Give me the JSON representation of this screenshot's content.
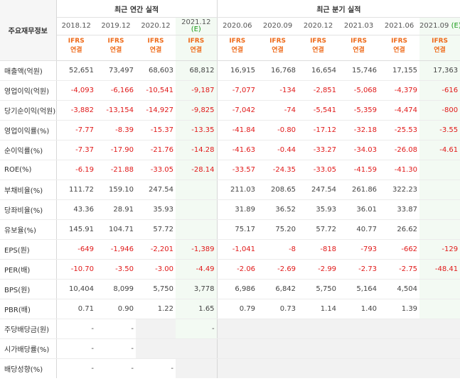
{
  "header": {
    "corner_label": "주요재무정보",
    "annual_title": "최근 연간 실적",
    "quarter_title": "최근 분기 실적",
    "annual_periods": [
      {
        "label": "2018.12",
        "est": ""
      },
      {
        "label": "2019.12",
        "est": ""
      },
      {
        "label": "2020.12",
        "est": ""
      },
      {
        "label": "2021.12",
        "est": "(E)"
      }
    ],
    "quarter_periods": [
      {
        "label": "2020.06",
        "est": ""
      },
      {
        "label": "2020.09",
        "est": ""
      },
      {
        "label": "2020.12",
        "est": ""
      },
      {
        "label": "2021.03",
        "est": ""
      },
      {
        "label": "2021.06",
        "est": ""
      },
      {
        "label": "2021.09",
        "est": "(E)"
      }
    ],
    "ifrs_label": "IFRS",
    "consol_label": "연결"
  },
  "rows": [
    {
      "label": "매출액(억원)",
      "values": [
        "52,651",
        "73,497",
        "68,603",
        "68,812",
        "16,915",
        "16,768",
        "16,654",
        "15,746",
        "17,155",
        "17,363"
      ]
    },
    {
      "label": "영업이익(억원)",
      "values": [
        "-4,093",
        "-6,166",
        "-10,541",
        "-9,187",
        "-7,077",
        "-134",
        "-2,851",
        "-5,068",
        "-4,379",
        "-616"
      ]
    },
    {
      "label": "당기순이익(억원)",
      "values": [
        "-3,882",
        "-13,154",
        "-14,927",
        "-9,825",
        "-7,042",
        "-74",
        "-5,541",
        "-5,359",
        "-4,474",
        "-800"
      ]
    },
    {
      "label": "영업이익률(%)",
      "values": [
        "-7.77",
        "-8.39",
        "-15.37",
        "-13.35",
        "-41.84",
        "-0.80",
        "-17.12",
        "-32.18",
        "-25.53",
        "-3.55"
      ]
    },
    {
      "label": "순이익률(%)",
      "values": [
        "-7.37",
        "-17.90",
        "-21.76",
        "-14.28",
        "-41.63",
        "-0.44",
        "-33.27",
        "-34.03",
        "-26.08",
        "-4.61"
      ]
    },
    {
      "label": "ROE(%)",
      "values": [
        "-6.19",
        "-21.88",
        "-33.05",
        "-28.14",
        "-33.57",
        "-24.35",
        "-33.05",
        "-41.59",
        "-41.30",
        ""
      ]
    },
    {
      "label": "부채비율(%)",
      "values": [
        "111.72",
        "159.10",
        "247.54",
        "",
        "211.03",
        "208.65",
        "247.54",
        "261.86",
        "322.23",
        ""
      ]
    },
    {
      "label": "당좌비율(%)",
      "values": [
        "43.36",
        "28.91",
        "35.93",
        "",
        "31.89",
        "36.52",
        "35.93",
        "36.01",
        "33.87",
        ""
      ]
    },
    {
      "label": "유보율(%)",
      "values": [
        "145.91",
        "104.71",
        "57.72",
        "",
        "75.17",
        "75.20",
        "57.72",
        "40.77",
        "26.62",
        ""
      ]
    },
    {
      "label": "EPS(원)",
      "values": [
        "-649",
        "-1,946",
        "-2,201",
        "-1,389",
        "-1,041",
        "-8",
        "-818",
        "-793",
        "-662",
        "-129"
      ]
    },
    {
      "label": "PER(배)",
      "values": [
        "-10.70",
        "-3.50",
        "-3.00",
        "-4.49",
        "-2.06",
        "-2.69",
        "-2.99",
        "-2.73",
        "-2.75",
        "-48.41"
      ]
    },
    {
      "label": "BPS(원)",
      "values": [
        "10,404",
        "8,099",
        "5,750",
        "3,778",
        "6,986",
        "6,842",
        "5,750",
        "5,164",
        "4,504",
        ""
      ]
    },
    {
      "label": "PBR(배)",
      "values": [
        "0.71",
        "0.90",
        "1.22",
        "1.65",
        "0.79",
        "0.73",
        "1.14",
        "1.40",
        "1.39",
        ""
      ]
    },
    {
      "label": "주당배당금(원)",
      "values": [
        "-",
        "-",
        "",
        "-",
        "",
        "",
        "",
        "",
        "",
        ""
      ]
    },
    {
      "label": "시가배당률(%)",
      "values": [
        "-",
        "-",
        "",
        "",
        "",
        "",
        "",
        "",
        "",
        ""
      ]
    },
    {
      "label": "배당성향(%)",
      "values": [
        "-",
        "-",
        "-",
        "",
        "",
        "",
        "",
        "",
        "",
        ""
      ]
    }
  ]
}
